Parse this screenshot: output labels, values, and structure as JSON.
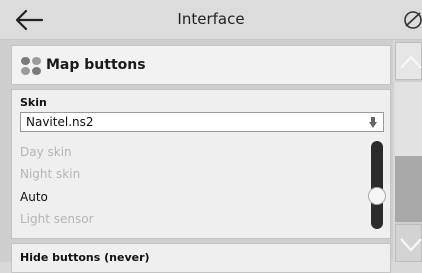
{
  "header": {
    "title": "Interface",
    "back_icon": "arrow-left-icon",
    "right_icon": "no-signal-icon"
  },
  "map_buttons": {
    "title": "Map buttons",
    "icon": "four-dots-icon"
  },
  "skin": {
    "label": "Skin",
    "selected": "Navitel.ns2",
    "options": [
      {
        "label": "Day skin",
        "enabled": false
      },
      {
        "label": "Night skin",
        "enabled": false
      },
      {
        "label": "Auto",
        "enabled": true
      },
      {
        "label": "Light sensor",
        "enabled": false
      }
    ],
    "selected_option": "Auto"
  },
  "hide_buttons": {
    "label": "Hide buttons (never)"
  },
  "colors": {
    "background": "#d9d9d9",
    "card": "#efefef",
    "disabled_text": "#b5b5b5",
    "slider": "#2b2b2b",
    "scroll_thumb": "#a9a9a9"
  }
}
